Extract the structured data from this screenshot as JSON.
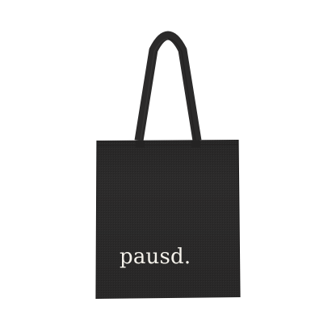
{
  "product": {
    "print_text": "pausd.",
    "bag_color": "#2c2b2b",
    "print_color": "#f4f1ea",
    "background_color": "#ffffff"
  }
}
